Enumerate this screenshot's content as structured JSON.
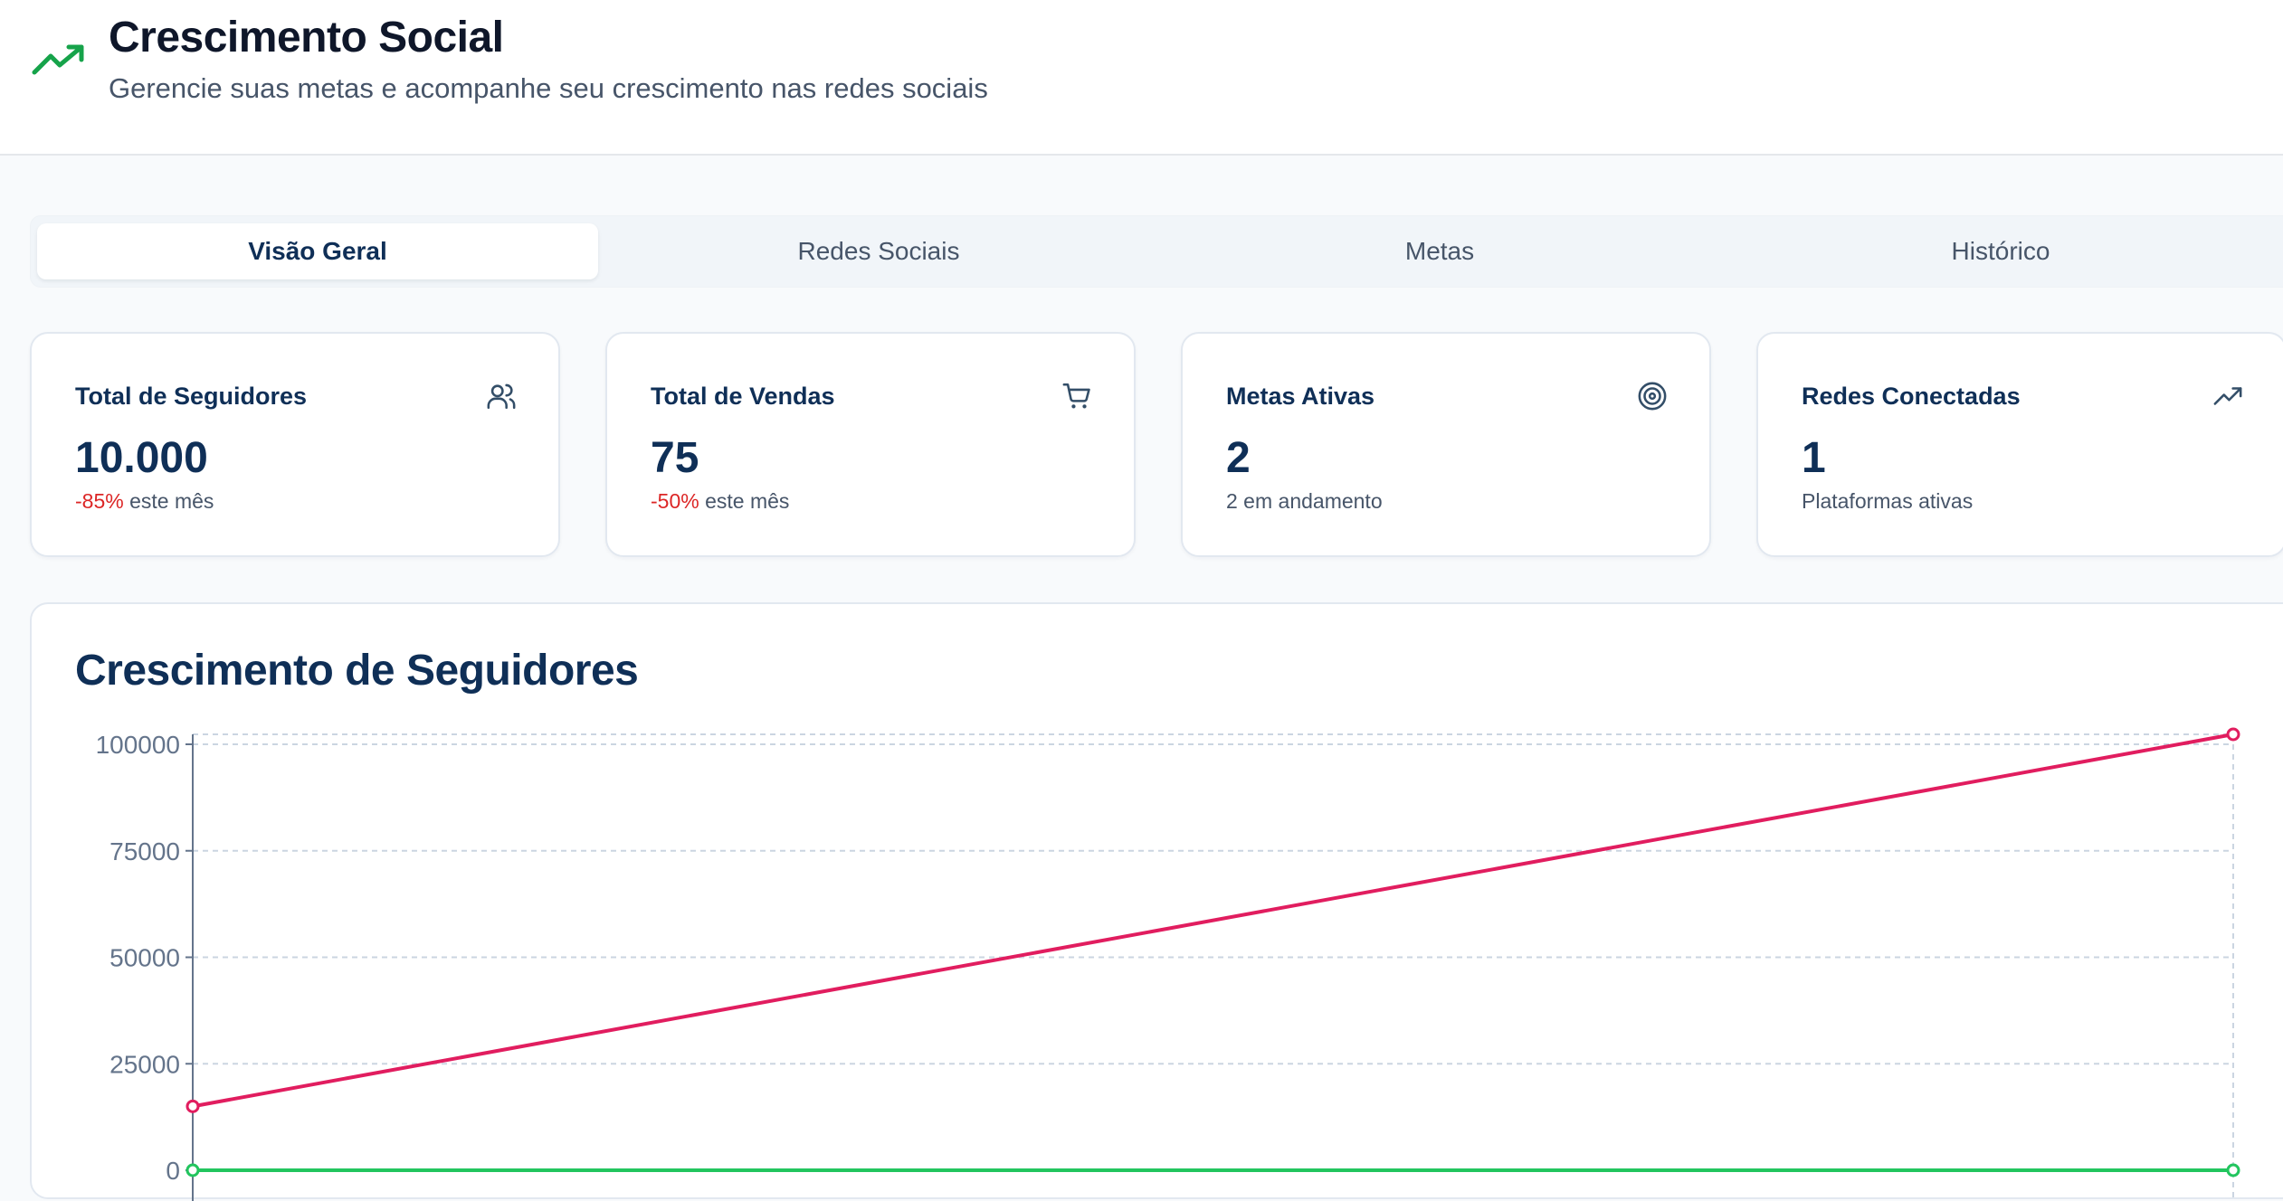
{
  "header": {
    "title": "Crescimento Social",
    "subtitle": "Gerencie suas metas e acompanhe seu crescimento nas redes sociais",
    "icon": "trending-up-icon",
    "icon_color": "#16a34a"
  },
  "tabs": [
    {
      "label": "Visão Geral",
      "active": true
    },
    {
      "label": "Redes Sociais",
      "active": false
    },
    {
      "label": "Metas",
      "active": false
    },
    {
      "label": "Histórico",
      "active": false
    }
  ],
  "stats": [
    {
      "title": "Total de Seguidores",
      "value": "10.000",
      "change": "-85%",
      "note": " este mês",
      "icon": "users-icon"
    },
    {
      "title": "Total de Vendas",
      "value": "75",
      "change": "-50%",
      "note": " este mês",
      "icon": "shopping-cart-icon"
    },
    {
      "title": "Metas Ativas",
      "value": "2",
      "change": "",
      "note": "2 em andamento",
      "icon": "target-icon"
    },
    {
      "title": "Redes Conectadas",
      "value": "1",
      "change": "",
      "note": "Plataformas ativas",
      "icon": "trending-up-icon"
    }
  ],
  "colors": {
    "negative": "#dc2626",
    "series_followers": "#e11d5f",
    "series_sales": "#22c55e"
  },
  "chart": {
    "title": "Crescimento de Seguidores"
  },
  "chart_data": {
    "type": "line",
    "title": "Crescimento de Seguidores",
    "xlabel": "",
    "ylabel": "",
    "ylim": [
      0,
      100000
    ],
    "yticks": [
      0,
      25000,
      50000,
      75000,
      100000
    ],
    "grid": true,
    "x": [
      0,
      1
    ],
    "series": [
      {
        "values": [
          15000,
          100000
        ],
        "color": "#e11d5f"
      },
      {
        "values": [
          0,
          0
        ],
        "color": "#22c55e"
      }
    ]
  }
}
